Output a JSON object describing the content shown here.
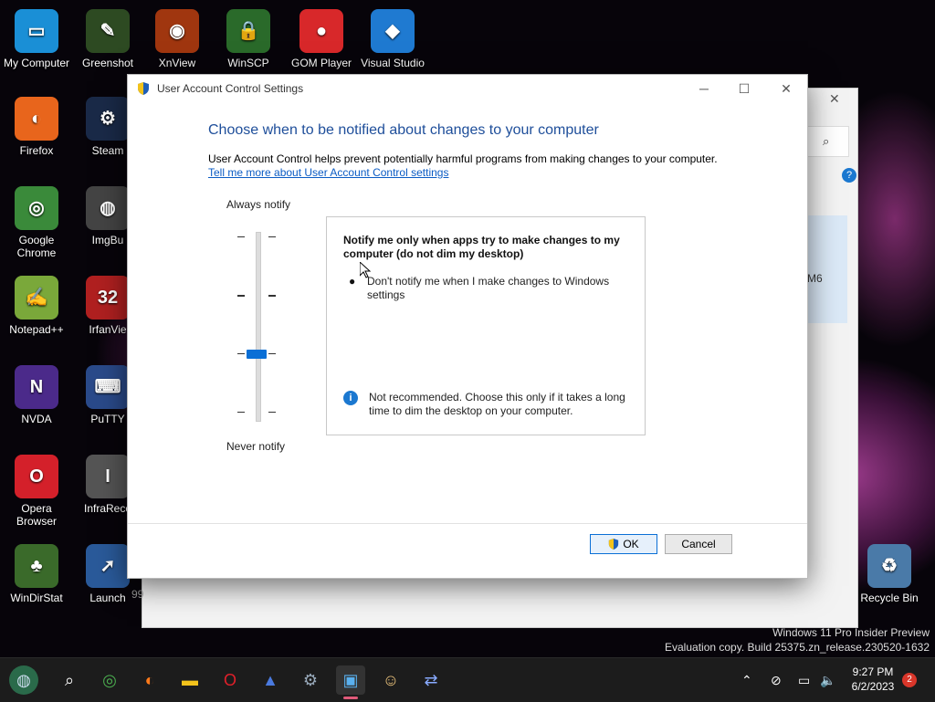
{
  "desktop": {
    "icons": [
      {
        "label": "My Computer",
        "color": "#1a8fd6",
        "glyph": "▭"
      },
      {
        "label": "Greenshot",
        "color": "#2d4a22",
        "glyph": "✎"
      },
      {
        "label": "XnView",
        "color": "#a0360f",
        "glyph": "◉"
      },
      {
        "label": "WinSCP",
        "color": "#2a6a2a",
        "glyph": "🔒"
      },
      {
        "label": "GOM Player",
        "color": "#d8282a",
        "glyph": "●"
      },
      {
        "label": "Visual Studio",
        "color": "#1f7ad1",
        "glyph": "◆"
      },
      {
        "label": "Firefox",
        "color": "#e8651c",
        "glyph": "◐"
      },
      {
        "label": "Steam",
        "color": "#1a2a48",
        "glyph": "⚙"
      },
      {
        "label": "Google Chrome",
        "color": "#3a8a3a",
        "glyph": "◎"
      },
      {
        "label": "ImgBu",
        "color": "#444",
        "glyph": "◍"
      },
      {
        "label": "Notepad++",
        "color": "#7aa83a",
        "glyph": "✍"
      },
      {
        "label": "IrfanVie",
        "color": "#b02020",
        "glyph": "32"
      },
      {
        "label": "NVDA",
        "color": "#4b2a8a",
        "glyph": "N"
      },
      {
        "label": "PuTTY",
        "color": "#2a4a8a",
        "glyph": "⌨"
      },
      {
        "label": "Opera Browser",
        "color": "#d4202a",
        "glyph": "O"
      },
      {
        "label": "InfraReco",
        "color": "#555",
        "glyph": "I"
      },
      {
        "label": "WinDirStat",
        "color": "#3a6a2a",
        "glyph": "♣"
      },
      {
        "label": "Launch",
        "color": "#2a5a9a",
        "glyph": "➚"
      },
      {
        "label": "Recycle Bin",
        "color": "#4a7aa8",
        "glyph": "♻"
      }
    ]
  },
  "background_window": {
    "partial_text": "M6",
    "partial_text2": "99"
  },
  "dialog": {
    "title": "User Account Control Settings",
    "heading": "Choose when to be notified about changes to your computer",
    "description": "User Account Control helps prevent potentially harmful programs from making changes to your computer.",
    "link": "Tell me more about User Account Control settings",
    "slider_top_label": "Always notify",
    "slider_bottom_label": "Never notify",
    "slider_level": "3 of 4",
    "info_title": "Notify me only when apps try to make changes to my computer (do not dim my desktop)",
    "bullet_text": "Don't notify me when I make changes to Windows settings",
    "warning_text": "Not recommended. Choose this only if it takes a long time to dim the desktop on your computer.",
    "ok_label": "OK",
    "cancel_label": "Cancel",
    "accent": "#0a6fd6",
    "heading_color": "#1e4e9a"
  },
  "watermark": {
    "line1": "Windows 11 Pro Insider Preview",
    "line2": "Evaluation copy. Build 25375.zn_release.230520-1632"
  },
  "taskbar": {
    "time": "9:27 PM",
    "date": "6/2/2023",
    "notification_count": "2"
  }
}
